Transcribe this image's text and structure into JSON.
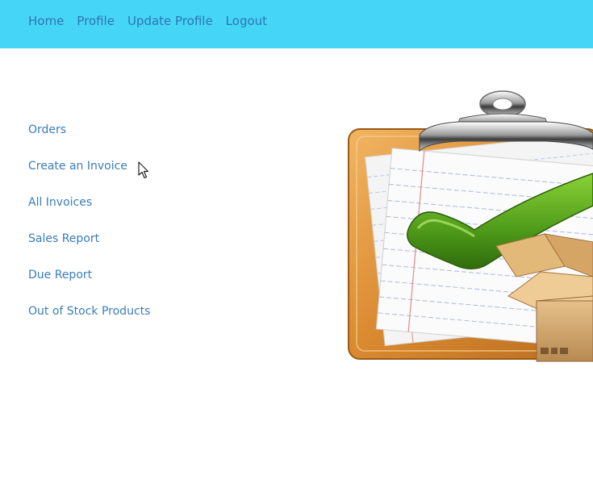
{
  "topnav": {
    "items": [
      "Home",
      "Profile",
      "Update Profile",
      "Logout"
    ]
  },
  "sidenav": {
    "items": [
      "Orders",
      "Create an Invoice",
      "All Invoices",
      "Sales Report",
      "Due Report",
      "Out of Stock Products"
    ]
  },
  "colors": {
    "topbar_bg": "#45d6f7",
    "link": "#3a7dbb"
  },
  "icons": {
    "cursor": "mouse-pointer-icon",
    "illustration": "clipboard-checkmark-box-illustration"
  }
}
